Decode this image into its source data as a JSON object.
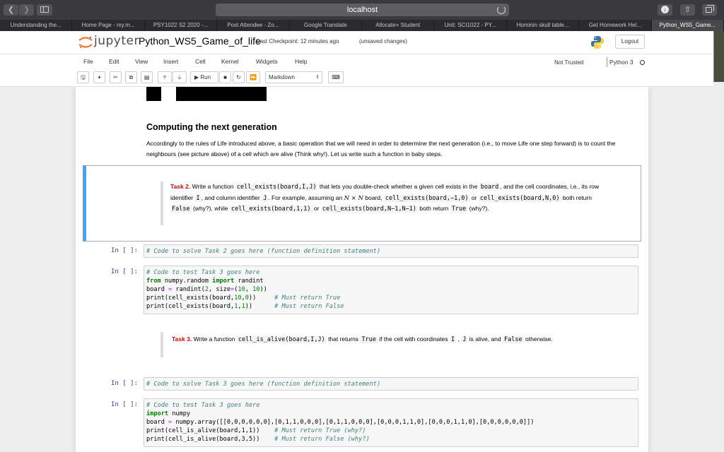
{
  "browser": {
    "address": "localhost",
    "tabs": [
      {
        "label": "Understanding the..."
      },
      {
        "label": "Home Page - my.m..."
      },
      {
        "label": "PSY1022 S2 2020 -..."
      },
      {
        "label": "Post Attendee - Zo..."
      },
      {
        "label": "Google Translate"
      },
      {
        "label": "Allocate+ Student"
      },
      {
        "label": "Unit: SCI1022 - PY..."
      },
      {
        "label": "Hominin skull table..."
      },
      {
        "label": "Get Homework Hel..."
      },
      {
        "label": "Python_WS5_Game..."
      }
    ],
    "active_tab_index": 9
  },
  "header": {
    "logo_text": "jupyter",
    "notebook_name": "Python_WS5_Game_of_life",
    "checkpoint": "Last Checkpoint: 12 minutes ago",
    "unsaved": "(unsaved changes)",
    "logout_label": "Logout"
  },
  "menu": {
    "items": [
      "File",
      "Edit",
      "View",
      "Insert",
      "Cell",
      "Kernel",
      "Widgets",
      "Help"
    ],
    "trust_status": "Not Trusted",
    "kernel": "Python 3"
  },
  "toolbar": {
    "run_label": "Run",
    "cell_type": "Markdown"
  },
  "content": {
    "heading": "Computing the next generation",
    "paragraph": "Accordingly to the rules of Life introduced above, a basic operation that we will need in order to determine the next generation (i.e., to move Life one step forward) is to count the neighbours (see picture above) of a cell which are alive (Think why!). Let us write such a function in baby steps.",
    "task2": {
      "title": "Task 2.",
      "t1": "Write a function",
      "c1": "cell_exists(board,I,J)",
      "t2": "that lets you double-check whether a given cell exists in the",
      "c2": "board",
      "t3": ", and the cell coordinates, i.e., its row identifier",
      "c3": "I",
      "t4": ", and column identifier",
      "c4": "J",
      "t5": ". For example, assuming an",
      "m1": "N × N",
      "t6": "board,",
      "c5": "cell_exists(board,−1,0)",
      "t7": "or",
      "c6": "cell_exists(board,N,0)",
      "t8": "both return",
      "c7": "False",
      "t9": "(why?), while",
      "c8": "cell_exists(board,1,1)",
      "t10": "or",
      "c9": "cell_exists(board,N−1,N−1)",
      "t11": "both return",
      "c10": "True",
      "t12": "(why?)."
    },
    "task3": {
      "title": "Task 3.",
      "t1": "Write a function",
      "c1": "cell_is_alive(board,I,J)",
      "t2": "that returns",
      "c2": "True",
      "t3": "if the cell with coordinates",
      "c3": "I",
      "t4": ",",
      "c4": "J",
      "t5": "is alive, and",
      "c5": "False",
      "t6": "otherwise."
    },
    "prompt": "In [ ]:",
    "cell1": {
      "comment": "# Code to solve Task 2 goes here (function definition statement)"
    },
    "cell2": {
      "comment": "# Code to test Task 3 goes here",
      "l2_from": "from",
      "l2_mod": " numpy.random ",
      "l2_import": "import",
      "l2_name": " randint",
      "l3_a": "board ",
      "l3_eq": "=",
      "l3_b": " randint(",
      "l3_n1": "2",
      "l3_c": ", size",
      "l3_eq2": "=",
      "l3_d": "(",
      "l3_n2": "10",
      "l3_e": ", ",
      "l3_n3": "10",
      "l3_f": "))",
      "l4_a": "print(cell_exists(board,",
      "l4_n1": "10",
      "l4_b": ",",
      "l4_n2": "0",
      "l4_c": "))     ",
      "l4_cm": "# Must return True",
      "l5_a": "print(cell_exists(board,",
      "l5_n1": "1",
      "l5_b": ",",
      "l5_n2": "1",
      "l5_c": "))      ",
      "l5_cm": "# Must return False"
    },
    "cell3": {
      "comment": "# Code to solve Task 3 goes here (function definition statement)"
    },
    "cell4": {
      "comment": "# Code to test Task 3 goes here",
      "l2_import": "import",
      "l2_name": " numpy",
      "l3_a": "board ",
      "l3_eq": "=",
      "l3_b": " numpy.array([[0,0,0,0,0,0],[0,1,1,0,0,0],[0,1,1,0,0,0],[0,0,0,1,1,0],[0,0,0,1,1,0],[0,0,0,0,0,0]])",
      "l4_a": "print(cell_is_alive(board,1,1))    ",
      "l4_cm": "# Must return True (why?)",
      "l5_a": "print(cell_is_alive(board,3,5))    ",
      "l5_cm": "# Must return False (why?)"
    }
  }
}
